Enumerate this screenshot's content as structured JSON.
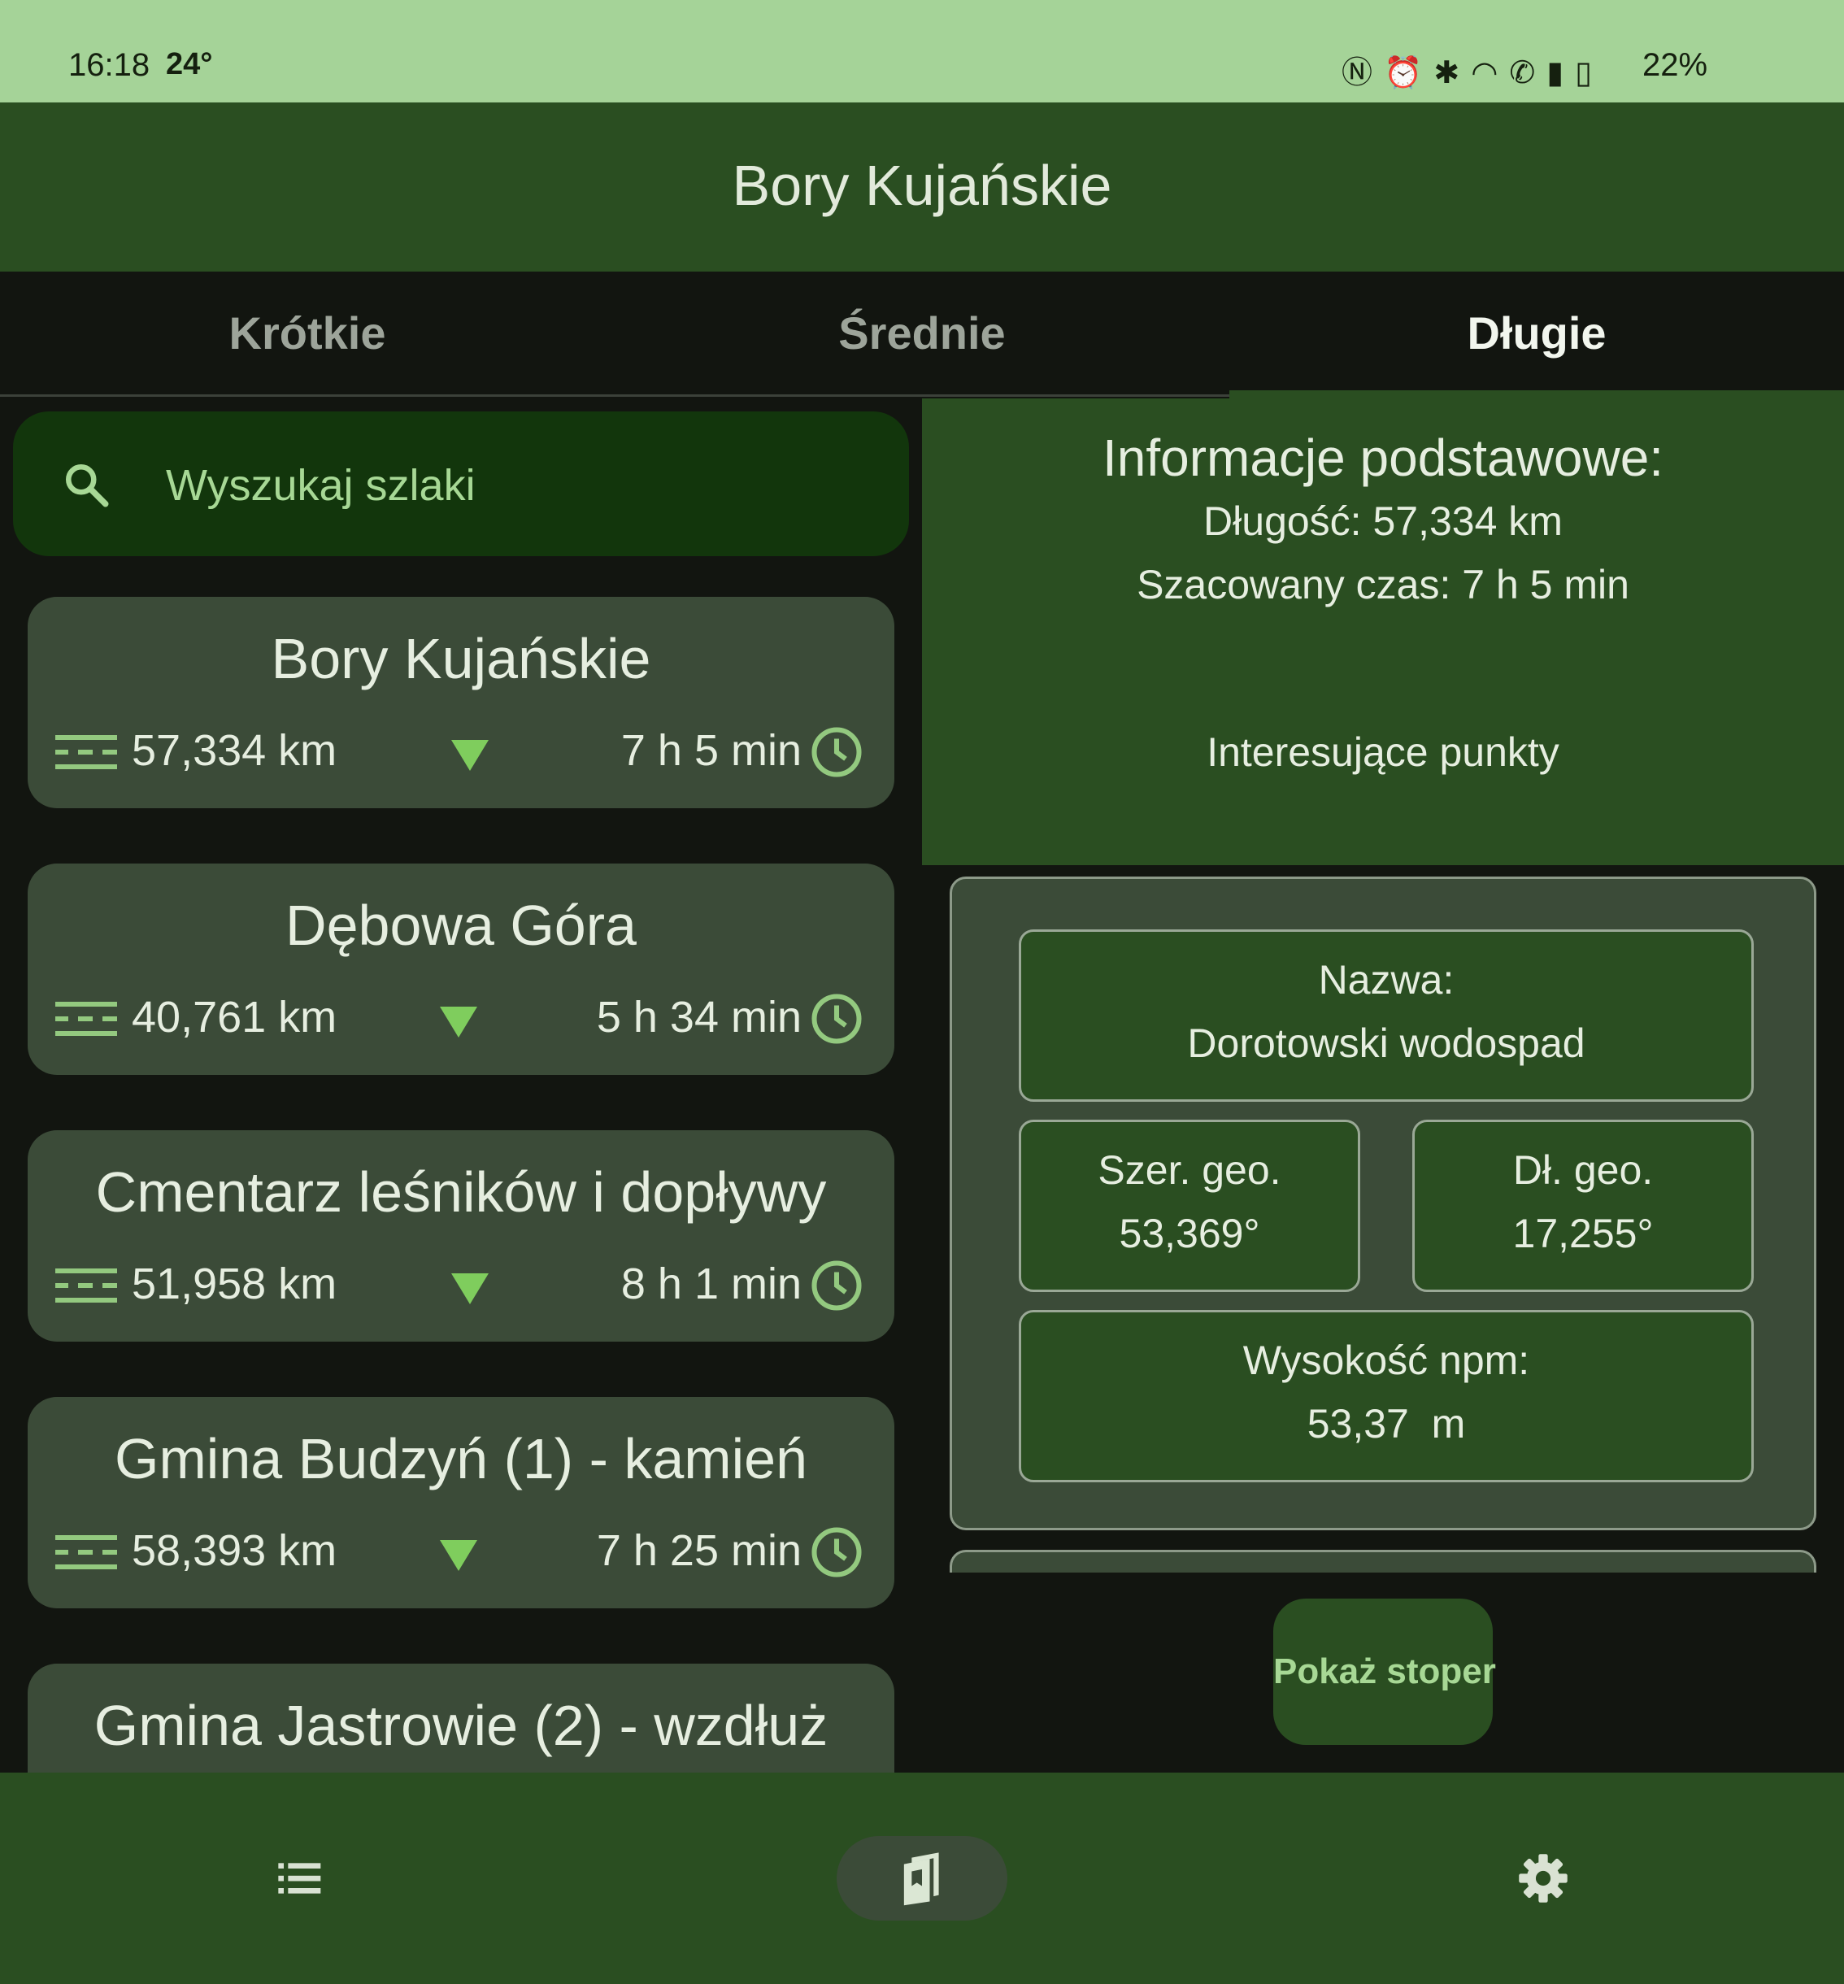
{
  "status_bar": {
    "time": "16:18",
    "temperature": "24°",
    "icons": [
      "nfc-icon",
      "alarm-icon",
      "bluetooth-icon",
      "wifi-icon",
      "wifi-calling-icon",
      "signal-icon",
      "battery-icon"
    ],
    "battery": "22%"
  },
  "app_bar": {
    "title": "Bory Kujańskie"
  },
  "tabs": [
    {
      "label": "Krótkie",
      "active": false
    },
    {
      "label": "Średnie",
      "active": false
    },
    {
      "label": "Długie",
      "active": true
    }
  ],
  "search": {
    "placeholder": "Wyszukaj szlaki",
    "value": ""
  },
  "trails": [
    {
      "name": "Bory Kujańskie",
      "distance": "57,334 km",
      "time": "7 h 5 min"
    },
    {
      "name": "Dębowa Góra",
      "distance": "40,761 km",
      "time": "5 h 34 min"
    },
    {
      "name": "Cmentarz leśników i dopływy",
      "distance": "51,958 km",
      "time": "8 h 1 min"
    },
    {
      "name": "Gmina Budzyń (1) - kamień",
      "distance": "58,393 km",
      "time": "7 h 25 min"
    },
    {
      "name": "Gmina Jastrowie (2) - wzdłuż",
      "distance": "",
      "time": ""
    }
  ],
  "info": {
    "heading": "Informacje podstawowe:",
    "length_line": "Długość: 57,334 km",
    "time_line": "Szacowany czas: 7 h 5 min",
    "poi_heading": "Interesujące punkty"
  },
  "poi": {
    "name_label": "Nazwa:",
    "name_value": "Dorotowski wodospad",
    "lat_label": "Szer. geo.",
    "lat_value": "53,369°",
    "lon_label": "Dł. geo.",
    "lon_value": "17,255°",
    "alt_label": "Wysokość npm:",
    "alt_value": "53,37  m"
  },
  "stopwatch_button": "Pokaż stoper",
  "bottom_nav": [
    {
      "icon": "list-icon",
      "active": false
    },
    {
      "icon": "book-icon",
      "active": true
    },
    {
      "icon": "gear-icon",
      "active": false
    }
  ],
  "colors": {
    "primary_dark": "#2a4e21",
    "status_bar": "#a5d398",
    "card": "#3b4b38",
    "accent": "#7fcd5d",
    "background": "#121510",
    "search_bg": "#12360c"
  }
}
